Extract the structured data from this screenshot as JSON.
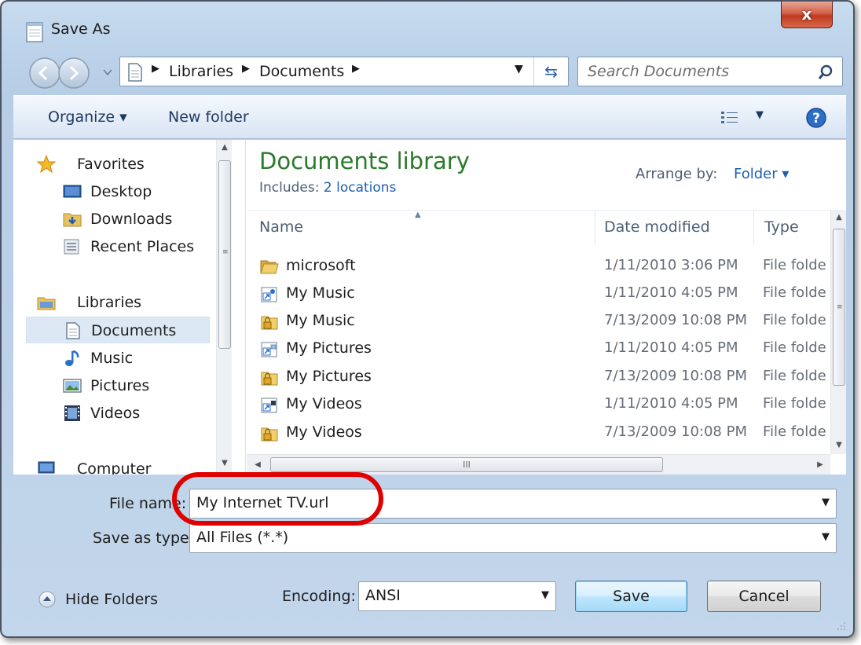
{
  "window": {
    "title": "Save As",
    "close_glyph": "x"
  },
  "navigation": {
    "breadcrumbs": [
      "Libraries",
      "Documents"
    ],
    "search_placeholder": "Search Documents"
  },
  "toolbar": {
    "organize_label": "Organize ▾",
    "new_folder_label": "New folder"
  },
  "sidebar": {
    "favorites_label": "Favorites",
    "favorites": [
      "Desktop",
      "Downloads",
      "Recent Places"
    ],
    "libraries_label": "Libraries",
    "libraries": [
      "Documents",
      "Music",
      "Pictures",
      "Videos"
    ],
    "computer_label": "Computer",
    "selected": "Documents"
  },
  "library": {
    "title": "Documents library",
    "includes_label": "Includes:",
    "locations_link": "2 locations",
    "arrange_label": "Arrange by:",
    "arrange_value": "Folder ▾"
  },
  "file_list": {
    "columns": [
      "Name",
      "Date modified",
      "Type"
    ],
    "rows": [
      {
        "name": "microsoft",
        "date": "1/11/2010 3:06 PM",
        "type": "File folder",
        "icon": "folder-icon"
      },
      {
        "name": "My Music",
        "date": "1/11/2010 4:05 PM",
        "type": "File folder",
        "icon": "music-shortcut-icon"
      },
      {
        "name": "My Music",
        "date": "7/13/2009 10:08 PM",
        "type": "File folder",
        "icon": "locked-folder-icon"
      },
      {
        "name": "My Pictures",
        "date": "1/11/2010 4:05 PM",
        "type": "File folder",
        "icon": "pictures-shortcut-icon"
      },
      {
        "name": "My Pictures",
        "date": "7/13/2009 10:08 PM",
        "type": "File folder",
        "icon": "locked-folder-icon"
      },
      {
        "name": "My Videos",
        "date": "1/11/2010 4:05 PM",
        "type": "File folder",
        "icon": "videos-shortcut-icon"
      },
      {
        "name": "My Videos",
        "date": "7/13/2009 10:08 PM",
        "type": "File folder",
        "icon": "locked-folder-icon"
      }
    ],
    "hscroll_grip": "III"
  },
  "form": {
    "file_name_label": "File name:",
    "file_name_value": "My Internet TV.url",
    "save_type_label": "Save as type:",
    "save_type_value": "All Files  (*.*)",
    "encoding_label": "Encoding:",
    "encoding_value": "ANSI"
  },
  "buttons": {
    "hide_folders": "Hide Folders",
    "save": "Save",
    "cancel": "Cancel"
  },
  "colors": {
    "library_title": "#2a7a2a",
    "link": "#1e5fb0",
    "highlight": "#e00000",
    "close_button": "#c0391f"
  }
}
